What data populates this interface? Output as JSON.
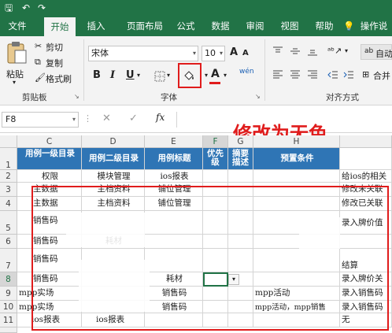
{
  "colors": {
    "accent": "#217346",
    "header_fill": "#2f75b5",
    "annotation": "#e01c1c"
  },
  "tabs": [
    "文件",
    "开始",
    "插入",
    "页面布局",
    "公式",
    "数据",
    "审阅",
    "视图",
    "帮助",
    "操作说"
  ],
  "ribbon": {
    "paste_label": "粘贴",
    "cut_label": "剪切",
    "copy_label": "复制",
    "format_painter_label": "格式刷",
    "clipboard_group": "剪贴板",
    "font_name": "宋体",
    "font_size": "10",
    "font_grow": "A",
    "font_shrink": "A",
    "bold": "B",
    "italic": "I",
    "underline": "U",
    "font_color_letter": "A",
    "phonetic": "wén",
    "font_group": "字体",
    "wrap_label": "自动",
    "merge_label": "合并",
    "align_group": "对齐方式"
  },
  "formula_bar": {
    "name_box": "F8",
    "fx": "fx"
  },
  "annotation_text": "修改为无色",
  "columns": [
    "C",
    "D",
    "E",
    "F",
    "G",
    "H"
  ],
  "rows": [
    "1",
    "2",
    "3",
    "4",
    "5",
    "6",
    "7",
    "8",
    "9",
    "10",
    "11"
  ],
  "sheet": {
    "r1": {
      "c": "用例一级目录",
      "d": "用例二级目录",
      "e": "用例标题",
      "f": "优先级",
      "g": "摘要描述",
      "h": "预置条件"
    },
    "r2": {
      "c": "权限",
      "d": "模块管理",
      "e": "ios报表",
      "i": "给ios的相关"
    },
    "r3": {
      "c": "主数据",
      "d": "主档资料",
      "e": "铺位管理",
      "i": "修改未关联"
    },
    "r4": {
      "c": "主数据",
      "d": "主档资料",
      "e": "铺位管理",
      "i": "修改已关联"
    },
    "r5": {
      "c": "销售码",
      "i": "录入牌价值"
    },
    "r6": {
      "c": "销售码",
      "d": "耗材"
    },
    "r7": {
      "c": "销售码",
      "i": "结算"
    },
    "r8": {
      "c": "销售码",
      "e": "耗材",
      "i": "录入牌价关"
    },
    "r9": {
      "c": "mpp实场",
      "e": "销售码",
      "h": "mpp活动",
      "i": "录入销售码"
    },
    "r10": {
      "c": "mpp实场",
      "e": "销售码",
      "h": "mpp活动，mpp销售",
      "i": "录入销售码"
    },
    "r11": {
      "c": "ios报表",
      "d": "ios报表",
      "i": "无"
    }
  }
}
